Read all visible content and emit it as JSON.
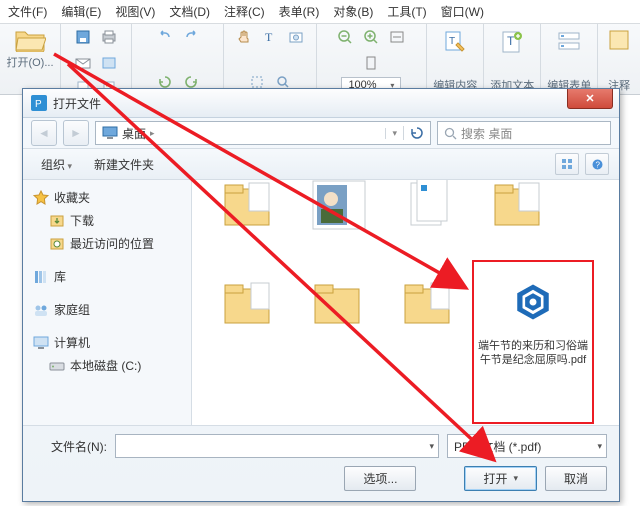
{
  "menu": {
    "file": "文件(F)",
    "edit": "编辑(E)",
    "view": "视图(V)",
    "doc": "文档(D)",
    "comment": "注释(C)",
    "table": "表单(R)",
    "object": "对象(B)",
    "tool": "工具(T)",
    "window": "窗口(W)"
  },
  "ribbon": {
    "open": "打开(O)...",
    "zoom": "100%",
    "edit_content": "编辑内容",
    "add_text": "添加文本",
    "edit_form": "编辑表单",
    "annotate": "注释"
  },
  "dialog": {
    "title": "打开文件",
    "location": "桌面",
    "search_placeholder": "搜索 桌面",
    "organize": "组织",
    "newfolder": "新建文件夹",
    "filename_label": "文件名(N):",
    "filter": "PDF 文档 (*.pdf)",
    "options": "选项...",
    "open": "打开",
    "cancel": "取消",
    "selected_file": "端午节的来历和习俗端午节是纪念屈原吗.pdf"
  },
  "sidebar": {
    "fav": "收藏夹",
    "downloads": "下载",
    "recent": "最近访问的位置",
    "libraries": "库",
    "homegroup": "家庭组",
    "computer": "计算机",
    "localdisk": "本地磁盘 (C:)"
  }
}
